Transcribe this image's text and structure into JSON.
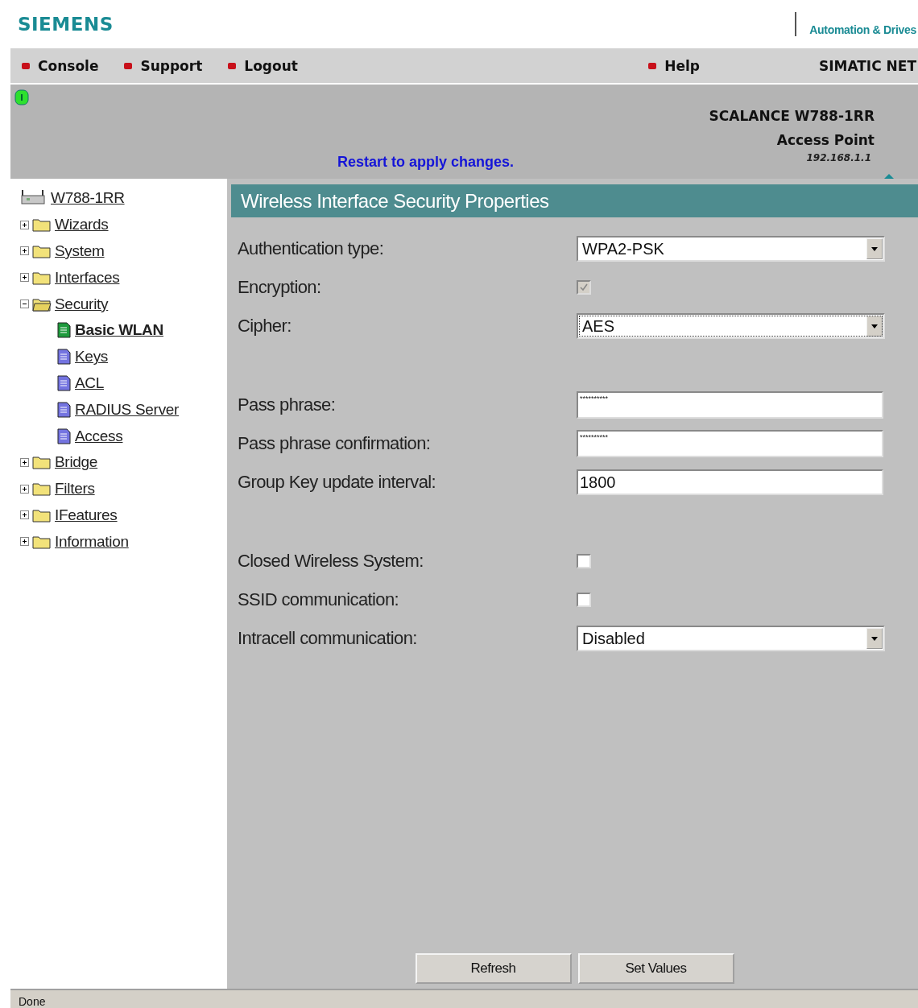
{
  "header": {
    "logo": "SIEMENS",
    "division": "Automation & Drives"
  },
  "nav": {
    "items": [
      {
        "label": "Console"
      },
      {
        "label": "Support"
      },
      {
        "label": "Logout"
      }
    ],
    "help": "Help",
    "product": "SIMATIC NET"
  },
  "device": {
    "notice": "Restart to apply changes.",
    "model": "SCALANCE W788-1RR",
    "role": "Access Point",
    "ip": "192.168.1.1"
  },
  "tree": {
    "root": "W788-1RR",
    "items": [
      {
        "label": "Wizards",
        "kind": "folder",
        "expanded": false
      },
      {
        "label": "System",
        "kind": "folder",
        "expanded": false
      },
      {
        "label": "Interfaces",
        "kind": "folder",
        "expanded": false
      },
      {
        "label": "Security",
        "kind": "folder",
        "expanded": true,
        "children": [
          {
            "label": "Basic WLAN",
            "kind": "page",
            "selected": true
          },
          {
            "label": "Keys",
            "kind": "page",
            "selected": false
          },
          {
            "label": "ACL",
            "kind": "page",
            "selected": false
          },
          {
            "label": "RADIUS Server",
            "kind": "page",
            "selected": false
          },
          {
            "label": "Access",
            "kind": "page",
            "selected": false
          }
        ]
      },
      {
        "label": "Bridge",
        "kind": "folder",
        "expanded": false
      },
      {
        "label": "Filters",
        "kind": "folder",
        "expanded": false
      },
      {
        "label": "IFeatures",
        "kind": "folder",
        "expanded": false
      },
      {
        "label": "Information",
        "kind": "folder",
        "expanded": false
      }
    ]
  },
  "panel": {
    "title": "Wireless Interface Security Properties",
    "groups": [
      [
        {
          "label": "Authentication type:",
          "kind": "select",
          "value": "WPA2-PSK",
          "focused": false
        },
        {
          "label": "Encryption:",
          "kind": "checkbox",
          "checked": true,
          "disabled": true
        },
        {
          "label": "Cipher:",
          "kind": "select",
          "value": "AES",
          "focused": true
        }
      ],
      [
        {
          "label": "Pass phrase:",
          "kind": "password",
          "value": "**********"
        },
        {
          "label": "Pass phrase confirmation:",
          "kind": "password",
          "value": "**********"
        },
        {
          "label": "Group Key update interval:",
          "kind": "text",
          "value": "1800"
        }
      ],
      [
        {
          "label": "Closed Wireless System:",
          "kind": "checkbox",
          "checked": false,
          "disabled": false
        },
        {
          "label": "SSID communication:",
          "kind": "checkbox",
          "checked": false,
          "disabled": false
        },
        {
          "label": "Intracell communication:",
          "kind": "select",
          "value": "Disabled",
          "focused": false
        }
      ]
    ],
    "buttons": [
      "Refresh",
      "Set Values"
    ]
  },
  "status_bar": "Done"
}
